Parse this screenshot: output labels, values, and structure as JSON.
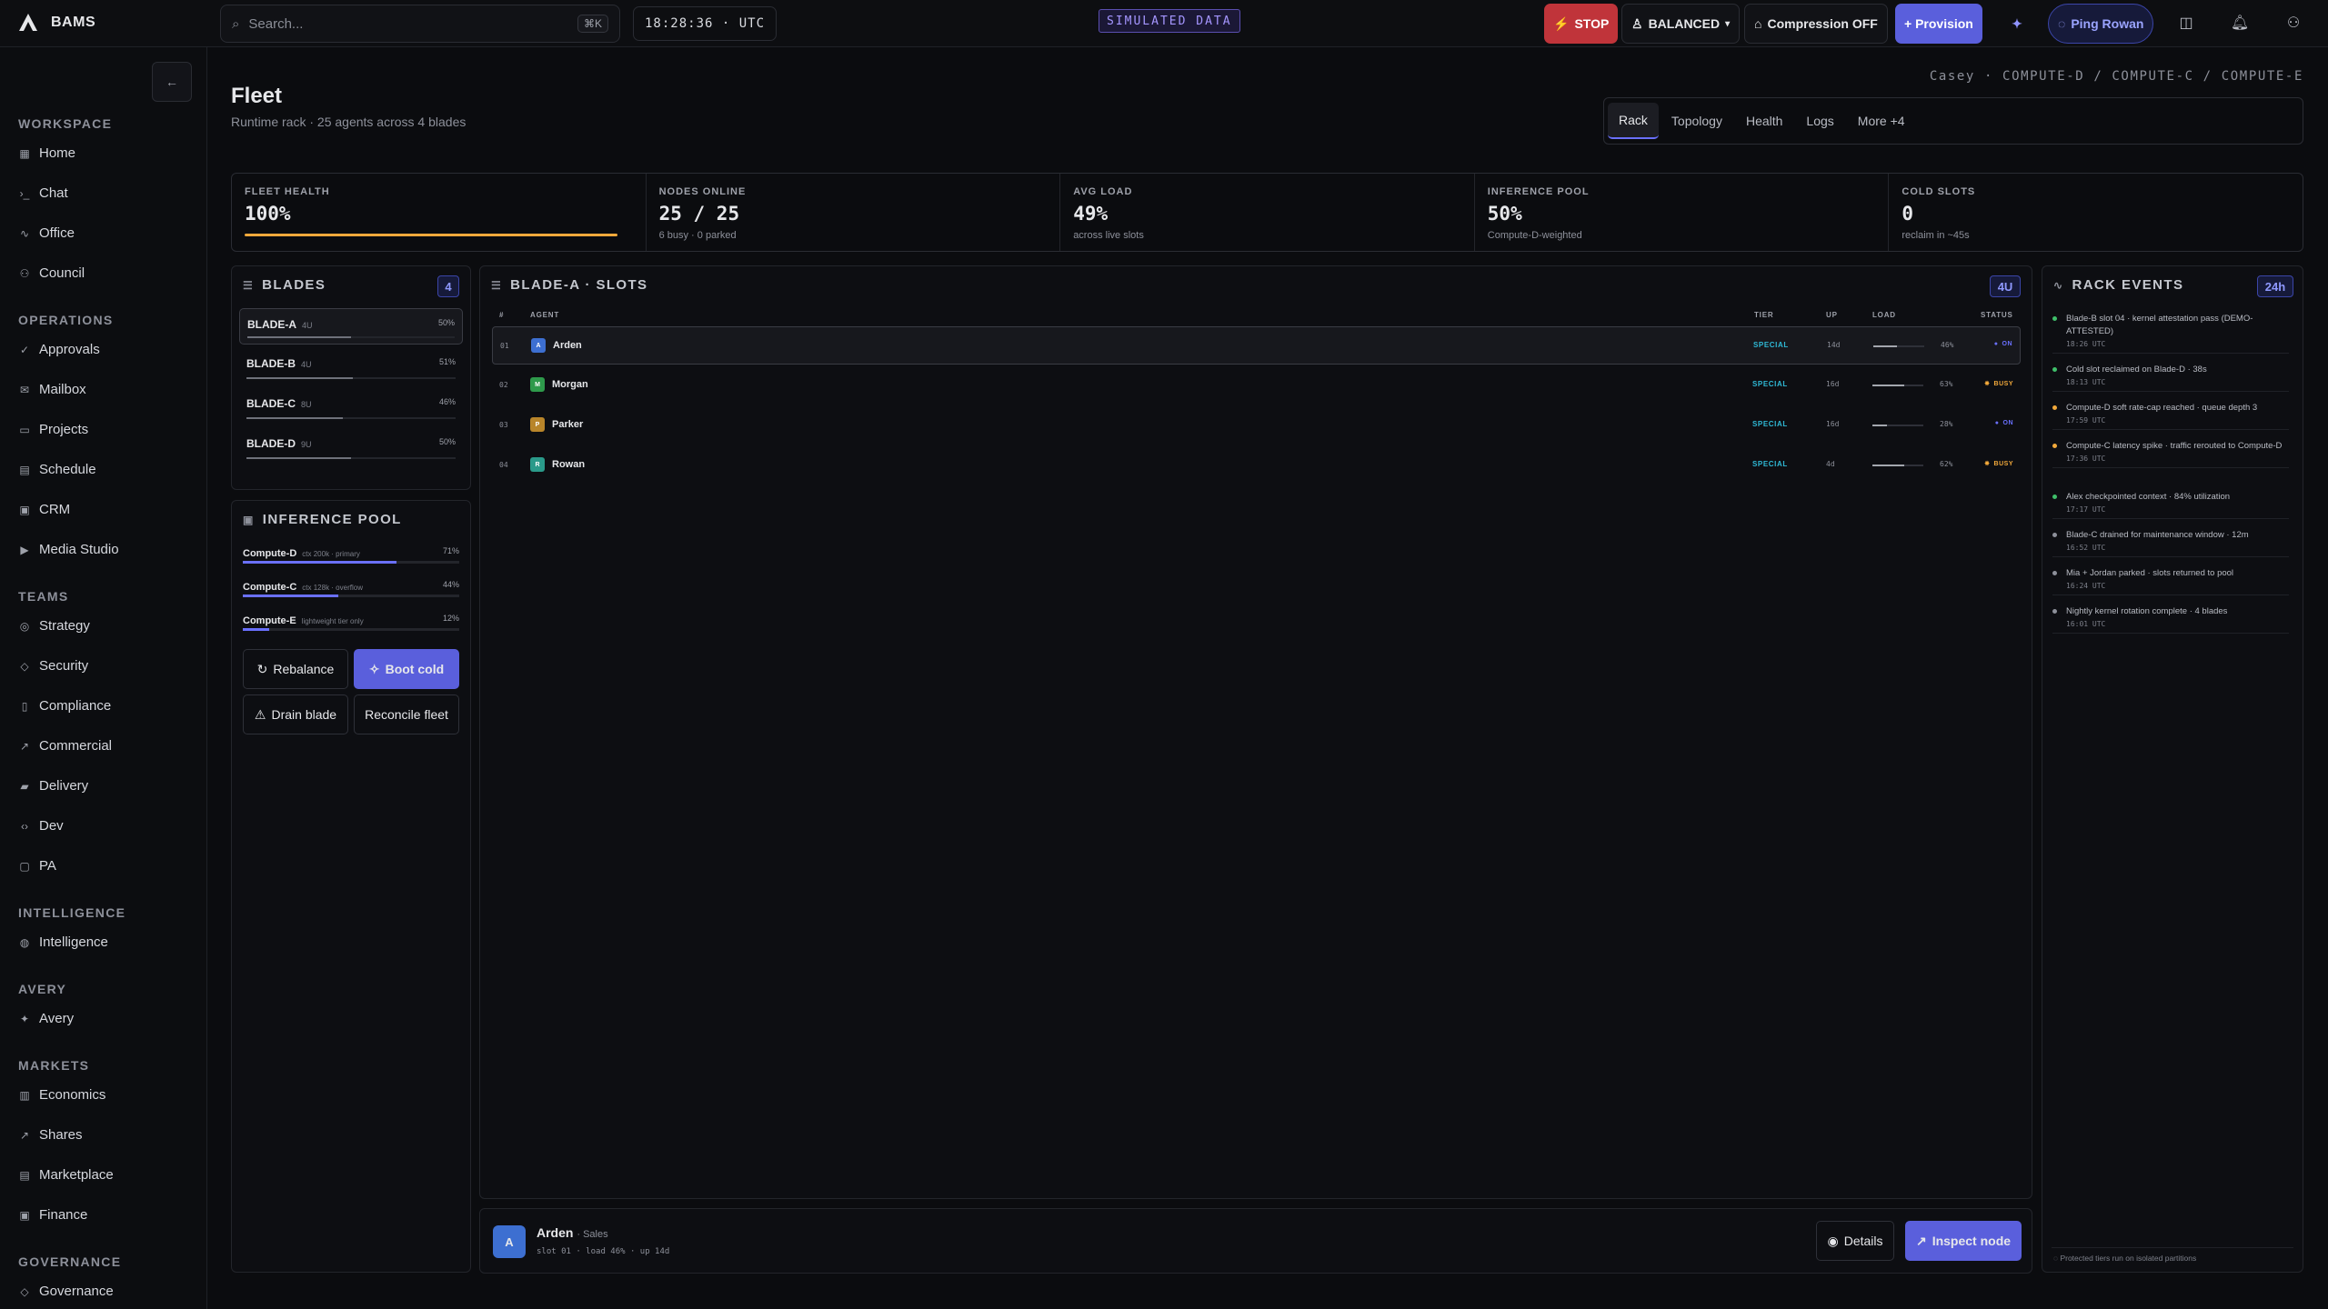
{
  "app": {
    "name": "BAMS",
    "clock": "18:28:36 · UTC",
    "sim_label": "SIMULATED DATA"
  },
  "search": {
    "placeholder": "Search...",
    "shortcut": "⌘K"
  },
  "top_actions": {
    "stop": "STOP",
    "mode": "BALANCED",
    "compression": "Compression OFF",
    "provision": "+ Provision",
    "ping": "Ping Rowan"
  },
  "sidebar": {
    "sections": [
      {
        "title": "WORKSPACE",
        "items": [
          "Home",
          "Chat",
          "Office",
          "Council"
        ]
      },
      {
        "title": "OPERATIONS",
        "items": [
          "Approvals",
          "Mailbox",
          "Projects",
          "Schedule",
          "CRM",
          "Media Studio"
        ]
      },
      {
        "title": "TEAMS",
        "items": [
          "Strategy",
          "Security",
          "Compliance",
          "Commercial",
          "Delivery",
          "Dev",
          "PA"
        ]
      },
      {
        "title": "INTELLIGENCE",
        "items": [
          "Intelligence"
        ]
      },
      {
        "title": "AVERY",
        "items": [
          "Avery"
        ]
      },
      {
        "title": "MARKETS",
        "items": [
          "Economics",
          "Shares",
          "Marketplace",
          "Finance"
        ]
      },
      {
        "title": "GOVERNANCE",
        "items": [
          "Governance"
        ]
      }
    ]
  },
  "page": {
    "title": "Fleet",
    "subtitle": "Runtime rack · 25 agents across 4 blades",
    "breadcrumb": "Casey · COMPUTE-D / COMPUTE-C / COMPUTE-E",
    "tabs": [
      "Rack",
      "Topology",
      "Health",
      "Logs",
      "More +4"
    ]
  },
  "kpis": [
    {
      "label": "FLEET HEALTH",
      "value": "100%",
      "sub": "",
      "fraction": 1.0
    },
    {
      "label": "NODES ONLINE",
      "value": "25 / 25",
      "sub": "6 busy · 0 parked"
    },
    {
      "label": "AVG LOAD",
      "value": "49%",
      "sub": "across live slots"
    },
    {
      "label": "INFERENCE POOL",
      "value": "50%",
      "sub": "Compute-D-weighted"
    },
    {
      "label": "COLD SLOTS",
      "value": "0",
      "sub": "reclaim in ~45s"
    }
  ],
  "blades_panel": {
    "title": "BLADES",
    "count": "4",
    "items": [
      {
        "name": "BLADE-A",
        "units": "4U",
        "pct": "50%",
        "load": 0.5
      },
      {
        "name": "BLADE-B",
        "units": "4U",
        "pct": "51%",
        "load": 0.51
      },
      {
        "name": "BLADE-C",
        "units": "8U",
        "pct": "46%",
        "load": 0.46
      },
      {
        "name": "BLADE-D",
        "units": "9U",
        "pct": "50%",
        "load": 0.5
      }
    ]
  },
  "pool_panel": {
    "title": "INFERENCE POOL",
    "items": [
      {
        "name": "Compute-D",
        "desc": "ctx 200k · primary",
        "pct": "71%",
        "load": 0.71
      },
      {
        "name": "Compute-C",
        "desc": "ctx 128k · overflow",
        "pct": "44%",
        "load": 0.44
      },
      {
        "name": "Compute-E",
        "desc": "lightweight tier only",
        "pct": "12%",
        "load": 0.12
      }
    ],
    "actions": {
      "rebalance": "Rebalance",
      "boot": "Boot cold",
      "drain": "Drain blade",
      "reconcile": "Reconcile fleet"
    }
  },
  "slots_panel": {
    "title": "BLADE-A · SLOTS",
    "badge": "4U",
    "headers": {
      "num": "#",
      "agent": "AGENT",
      "tier": "TIER",
      "up": "UP",
      "load": "LOAD",
      "status": "STATUS"
    },
    "rows": [
      {
        "num": "01",
        "initial": "A",
        "color": "#3d6fd1",
        "name": "Arden",
        "tier": "SPECIAL",
        "up": "14d",
        "load_pct": "46%",
        "load": 0.46,
        "status": "ON",
        "status_color": "#6a70ff"
      },
      {
        "num": "02",
        "initial": "M",
        "color": "#2e9a4b",
        "name": "Morgan",
        "tier": "SPECIAL",
        "up": "16d",
        "load_pct": "63%",
        "load": 0.63,
        "status": "BUSY",
        "status_color": "#f2a93b"
      },
      {
        "num": "03",
        "initial": "P",
        "color": "#b8852a",
        "name": "Parker",
        "tier": "SPECIAL",
        "up": "16d",
        "load_pct": "28%",
        "load": 0.28,
        "status": "ON",
        "status_color": "#6a70ff"
      },
      {
        "num": "04",
        "initial": "R",
        "color": "#2a9a8a",
        "name": "Rowan",
        "tier": "SPECIAL",
        "up": "4d",
        "load_pct": "62%",
        "load": 0.62,
        "status": "BUSY",
        "status_color": "#f2a93b"
      }
    ]
  },
  "footer": {
    "initial": "A",
    "name": "Arden",
    "role": "· Sales",
    "meta": "slot 01 · load 46% · up 14d",
    "details": "Details",
    "inspect": "Inspect node"
  },
  "events_panel": {
    "title": "RACK EVENTS",
    "range": "24h",
    "items": [
      {
        "text": "Blade-B slot 04 · kernel attestation pass (DEMO-ATTESTED)",
        "time": "18:26 UTC",
        "color": "#3fbf6a"
      },
      {
        "text": "Cold slot reclaimed on Blade-D · 38s",
        "time": "18:13 UTC",
        "color": "#3fbf6a"
      },
      {
        "text": "Compute-D soft rate-cap reached · queue depth 3",
        "time": "17:59 UTC",
        "color": "#f2a93b"
      },
      {
        "text": "Compute-C latency spike · traffic rerouted to Compute-D",
        "time": "17:36 UTC",
        "color": "#f2a93b"
      },
      {
        "text": "Alex checkpointed context · 84% utilization",
        "time": "17:17 UTC",
        "color": "#3fbf6a"
      },
      {
        "text": "Blade-C drained for maintenance window · 12m",
        "time": "16:52 UTC",
        "color": "#8d909a"
      },
      {
        "text": "Mia + Jordan parked · slots returned to pool",
        "time": "16:24 UTC",
        "color": "#8d909a"
      },
      {
        "text": "Nightly kernel rotation complete · 4 blades",
        "time": "16:01 UTC",
        "color": "#8d909a"
      }
    ],
    "footnote": "Protected tiers run on isolated partitions"
  }
}
